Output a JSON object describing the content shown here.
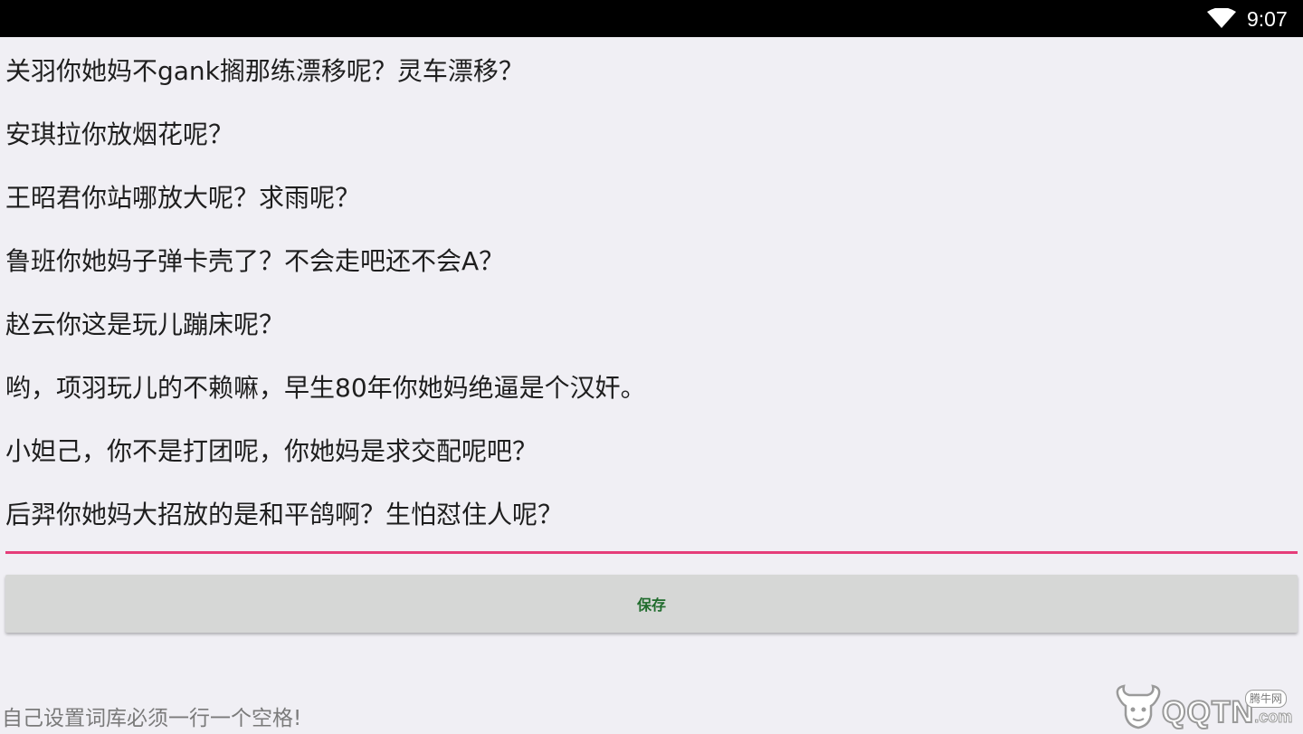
{
  "status_bar": {
    "time": "9:07",
    "wifi_icon": "wifi-icon",
    "background": "#000000"
  },
  "editor": {
    "lines": [
      "关羽你她妈不gank搁那练漂移呢？灵车漂移？",
      "安琪拉你放烟花呢？",
      "王昭君你站哪放大呢？求雨呢？",
      "鲁班你她妈子弹卡壳了？不会走吧还不会A？",
      "赵云你这是玩儿蹦床呢？",
      "哟，项羽玩儿的不赖嘛，早生80年你她妈绝逼是个汉奸。",
      "小妲己，你不是打团呢，你她妈是求交配呢吧？",
      "后羿你她妈大招放的是和平鸽啊？生怕怼住人呢？"
    ],
    "underline_color": "#e53d79"
  },
  "save_button": {
    "label": "保存",
    "text_color": "#1f6b2c",
    "background": "#d6d7d6"
  },
  "hint": {
    "text": "自己设置词库必须一行一个空格!"
  },
  "watermark": {
    "logo_icon": "bull-head-logo-icon",
    "text": "QQTN",
    "suffix": ".com",
    "badge": "腾牛网"
  }
}
